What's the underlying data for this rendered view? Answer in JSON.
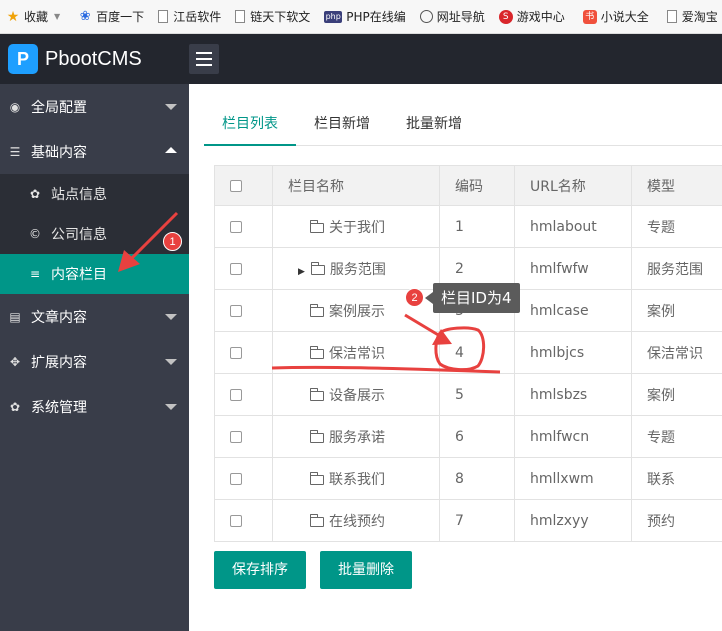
{
  "bookmarks": [
    {
      "label": "收藏",
      "icon": "star-icon"
    },
    {
      "label": "百度一下",
      "icon": "baidu-paw-icon"
    },
    {
      "label": "江岳软件",
      "icon": "page-icon"
    },
    {
      "label": "链天下软文",
      "icon": "page-icon"
    },
    {
      "label": "PHP在线编",
      "icon": "php-icon"
    },
    {
      "label": "网址导航",
      "icon": "globe-icon"
    },
    {
      "label": "游戏中心",
      "icon": "game-icon"
    },
    {
      "label": "小说大全",
      "icon": "novel-icon"
    },
    {
      "label": "爱淘宝",
      "icon": "page-icon"
    }
  ],
  "icon_glyphs": {
    "php": "php",
    "game": "S",
    "novel": "书",
    "logo": "P"
  },
  "app": {
    "name": "PbootCMS"
  },
  "sidebar": {
    "items": [
      {
        "label": "全局配置",
        "icon": "globe-icon"
      },
      {
        "label": "基础内容",
        "icon": "sliders-icon"
      },
      {
        "label": "文章内容",
        "icon": "document-icon"
      },
      {
        "label": "扩展内容",
        "icon": "expand-icon"
      },
      {
        "label": "系统管理",
        "icon": "gear-icon"
      }
    ],
    "sub_items": [
      {
        "label": "站点信息",
        "icon": "gear-icon"
      },
      {
        "label": "公司信息",
        "icon": "copyright-icon"
      },
      {
        "label": "内容栏目",
        "icon": "list-icon",
        "active": true
      }
    ]
  },
  "tabs": [
    {
      "label": "栏目列表",
      "active": true
    },
    {
      "label": "栏目新增"
    },
    {
      "label": "批量新增"
    }
  ],
  "table": {
    "headers": [
      "",
      "栏目名称",
      "编码",
      "URL名称",
      "模型"
    ],
    "rows": [
      {
        "name": "关于我们",
        "code": "1",
        "url": "hmlabout",
        "model": "专题"
      },
      {
        "name": "服务范围",
        "code": "2",
        "url": "hmlfwfw",
        "model": "服务范围",
        "expandable": true
      },
      {
        "name": "案例展示",
        "code": "3",
        "url": "hmlcase",
        "model": "案例"
      },
      {
        "name": "保洁常识",
        "code": "4",
        "url": "hmlbjcs",
        "model": "保洁常识"
      },
      {
        "name": "设备展示",
        "code": "5",
        "url": "hmlsbzs",
        "model": "案例"
      },
      {
        "name": "服务承诺",
        "code": "6",
        "url": "hmlfwcn",
        "model": "专题"
      },
      {
        "name": "联系我们",
        "code": "8",
        "url": "hmllxwm",
        "model": "联系"
      },
      {
        "name": "在线预约",
        "code": "7",
        "url": "hmlzxyy",
        "model": "预约"
      }
    ]
  },
  "buttons": {
    "save_sort": "保存排序",
    "batch_delete": "批量删除"
  },
  "annotations": {
    "badge1": "1",
    "badge2": "2",
    "tooltip": "栏目ID为4",
    "color": "#e8413f"
  },
  "colors": {
    "accent": "#009688",
    "sidebar": "#393d49",
    "topbar": "#23262e"
  }
}
